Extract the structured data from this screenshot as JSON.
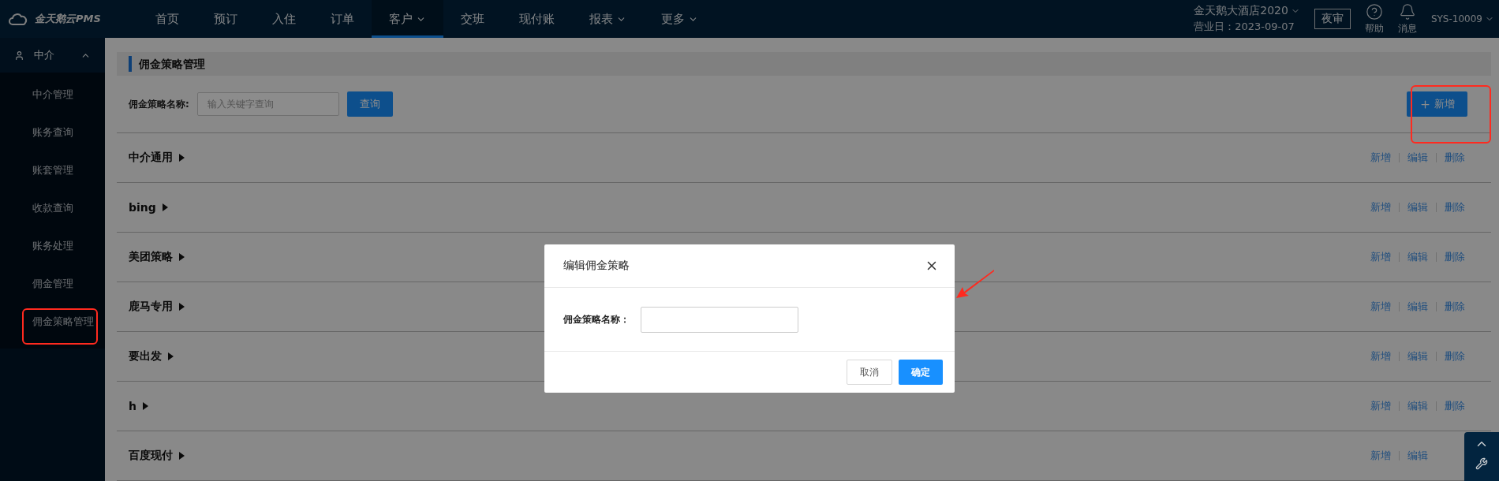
{
  "top_nav": {
    "logo": "金天鹅云PMS",
    "items": [
      {
        "label": "首页",
        "dropdown": false,
        "selected": false
      },
      {
        "label": "预订",
        "dropdown": false,
        "selected": false
      },
      {
        "label": "入住",
        "dropdown": false,
        "selected": false
      },
      {
        "label": "订单",
        "dropdown": false,
        "selected": false
      },
      {
        "label": "客户",
        "dropdown": true,
        "selected": true
      },
      {
        "label": "交班",
        "dropdown": false,
        "selected": false
      },
      {
        "label": "现付账",
        "dropdown": false,
        "selected": false
      },
      {
        "label": "报表",
        "dropdown": true,
        "selected": false
      },
      {
        "label": "更多",
        "dropdown": true,
        "selected": false
      }
    ],
    "hotel": {
      "name": "金天鹅大酒店2020",
      "business_date": "营业日：2023-09-07"
    },
    "audit_button": "夜审",
    "help": "帮助",
    "messages": "消息",
    "user": "SYS-10009"
  },
  "sidebar": {
    "group": {
      "label": "中介",
      "expanded": true,
      "items": [
        {
          "label": "中介管理"
        },
        {
          "label": "账务查询"
        },
        {
          "label": "账套管理"
        },
        {
          "label": "收款查询"
        },
        {
          "label": "账务处理"
        },
        {
          "label": "佣金管理"
        },
        {
          "label": "佣金策略管理"
        }
      ]
    }
  },
  "page_title": "佣金策略管理",
  "search": {
    "label": "佣金策略名称:",
    "placeholder": "输入关键字查询",
    "button": "查询"
  },
  "add_button": "新增",
  "strategies": [
    {
      "name": "中介通用",
      "actions": [
        "新增",
        "编辑",
        "删除"
      ]
    },
    {
      "name": "bing",
      "actions": [
        "新增",
        "编辑",
        "删除"
      ]
    },
    {
      "name": "美团策略",
      "actions": [
        "新增",
        "编辑",
        "删除"
      ]
    },
    {
      "name": "鹿马专用",
      "actions": [
        "新增",
        "编辑",
        "删除"
      ]
    },
    {
      "name": "要出发",
      "actions": [
        "新增",
        "编辑",
        "删除"
      ]
    },
    {
      "name": "h",
      "actions": [
        "新增",
        "编辑",
        "删除"
      ]
    },
    {
      "name": "百度现付",
      "actions": [
        "新增",
        "编辑"
      ]
    }
  ],
  "modal": {
    "title": "编辑佣金策略",
    "field_label": "佣金策略名称：",
    "cancel": "取消",
    "confirm": "确定"
  }
}
